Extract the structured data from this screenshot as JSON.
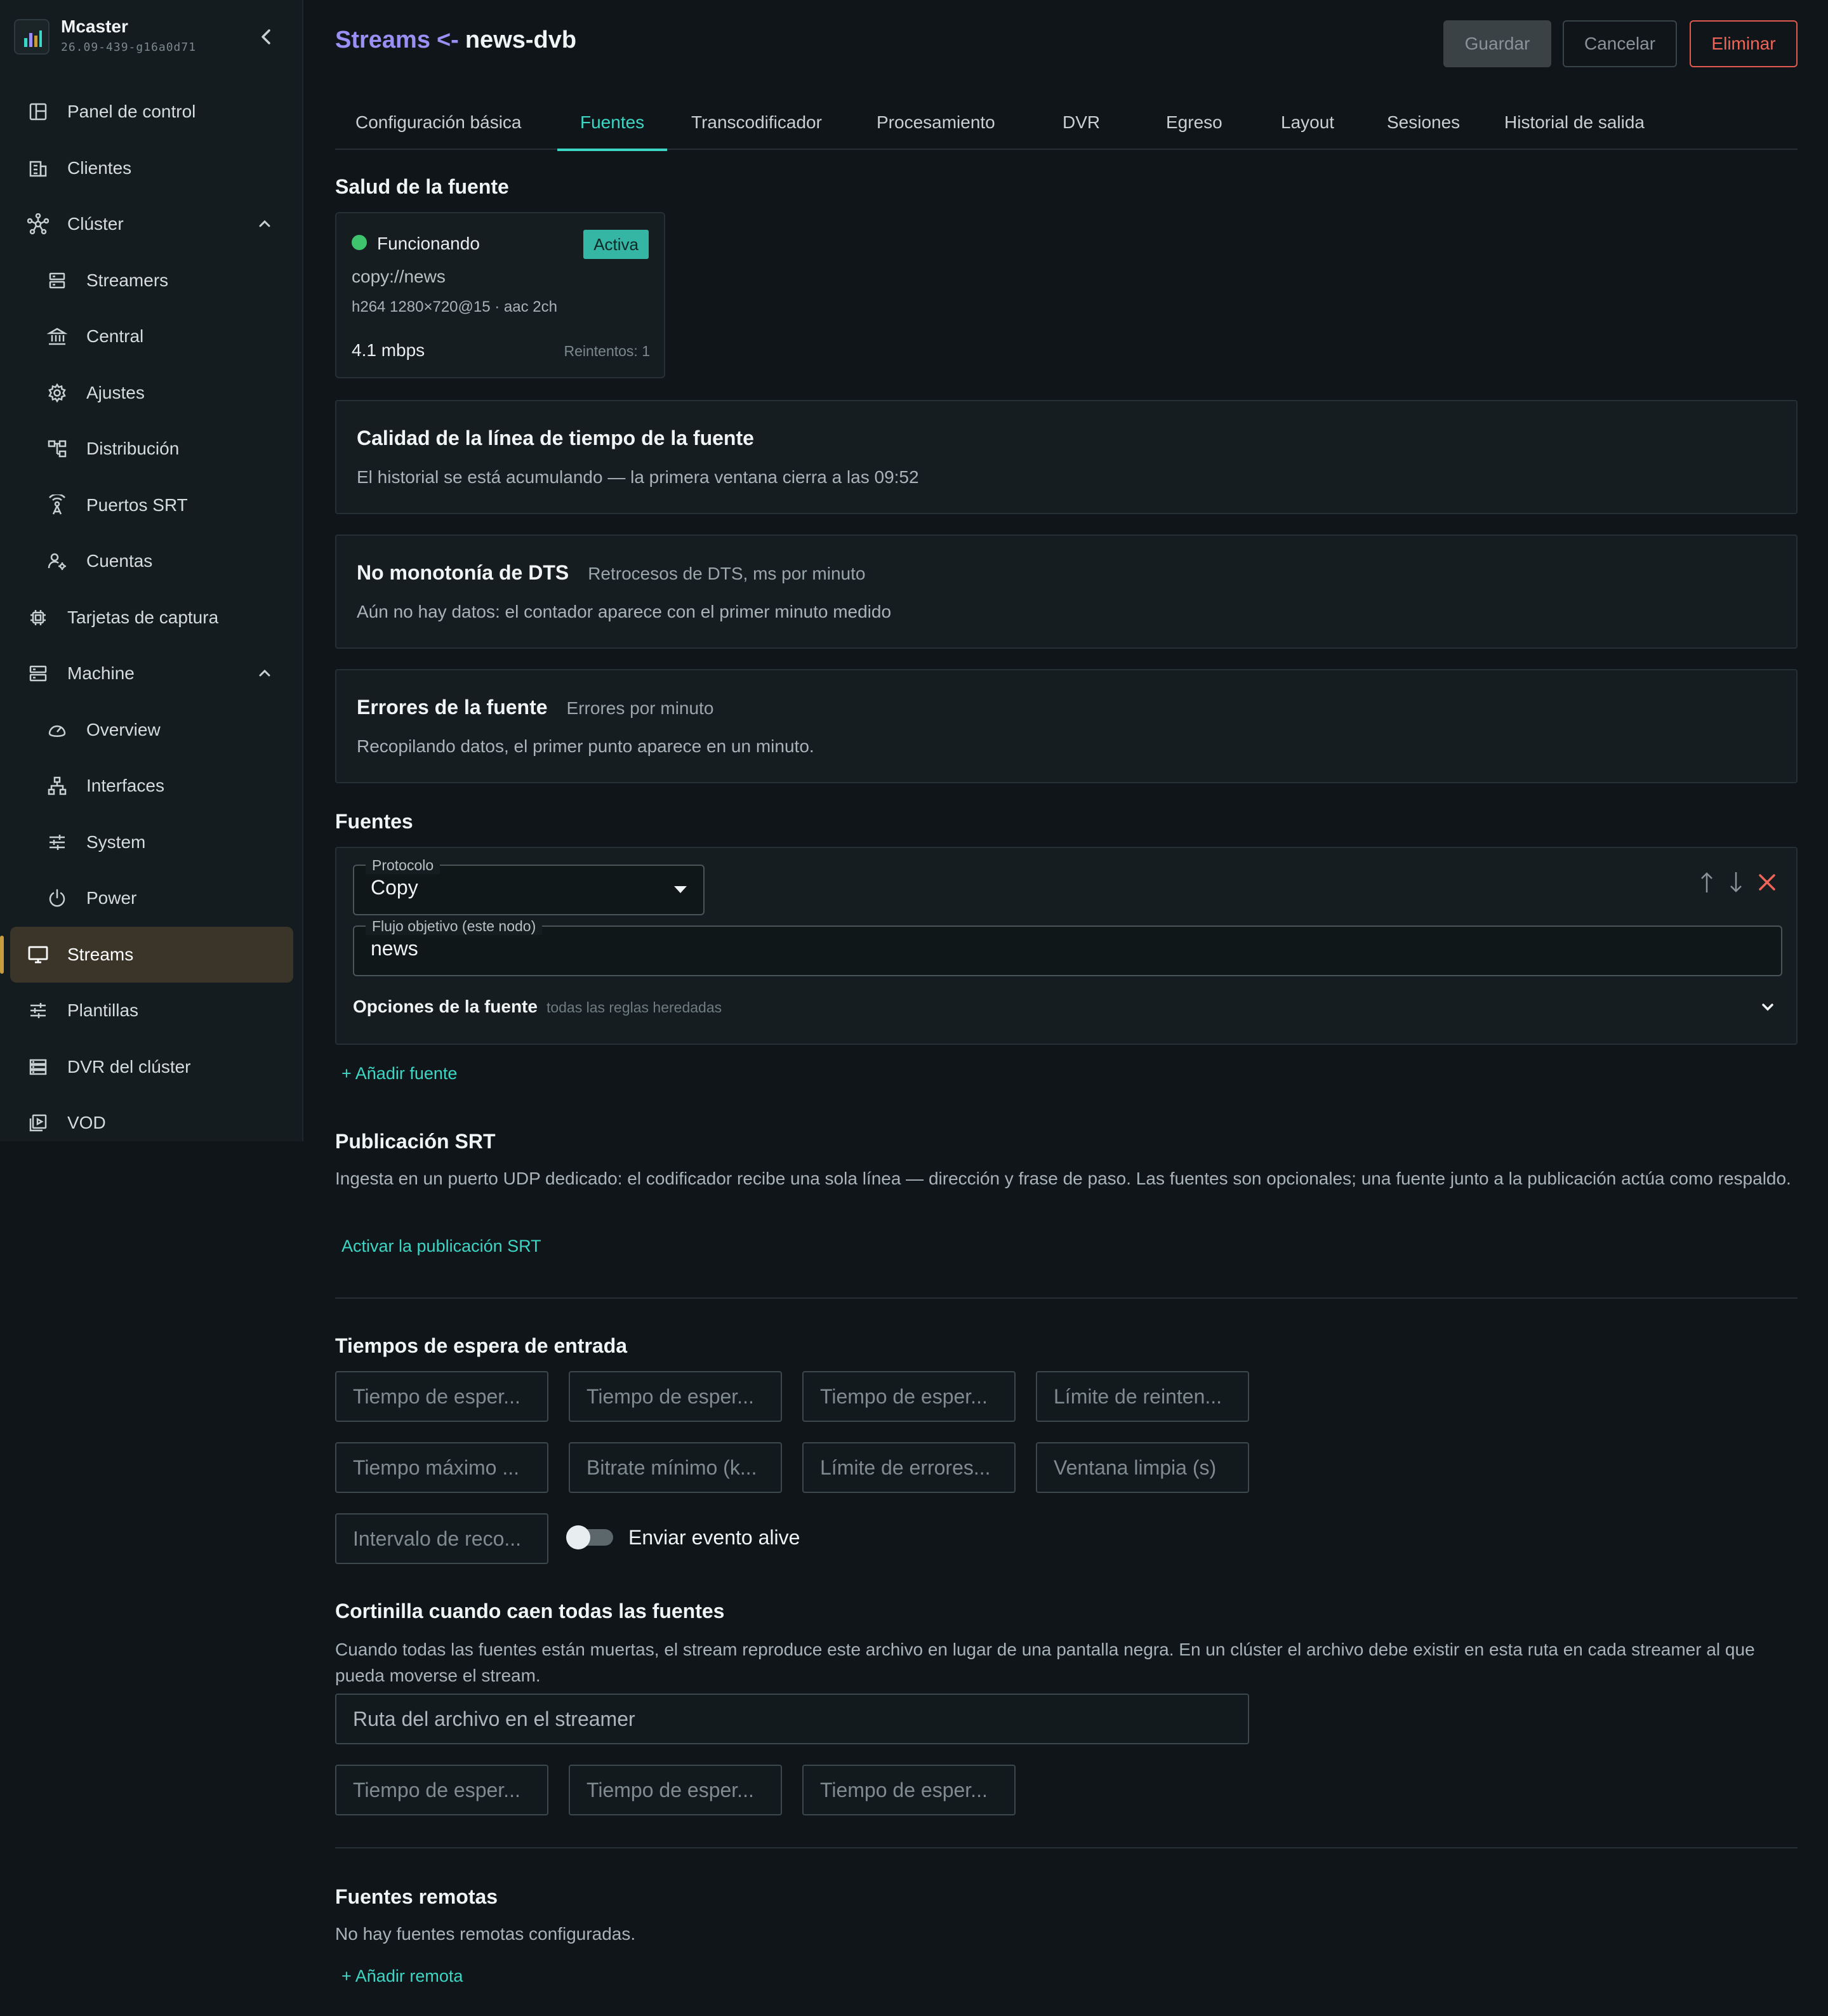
{
  "brand": {
    "name": "Mcaster",
    "version": "26.09-439-g16a0d71"
  },
  "nav": [
    {
      "label": "Panel de control",
      "icon": "dashboard-icon",
      "level": 0
    },
    {
      "label": "Clientes",
      "icon": "building-icon",
      "level": 0
    },
    {
      "label": "Clúster",
      "icon": "cluster-icon",
      "level": 0,
      "expanded": true
    },
    {
      "label": "Streamers",
      "icon": "server-icon",
      "level": 1
    },
    {
      "label": "Central",
      "icon": "bank-icon",
      "level": 1
    },
    {
      "label": "Ajustes",
      "icon": "gear-icon",
      "level": 1
    },
    {
      "label": "Distribución",
      "icon": "hierarchy-icon",
      "level": 1
    },
    {
      "label": "Puertos SRT",
      "icon": "antenna-icon",
      "level": 1
    },
    {
      "label": "Cuentas",
      "icon": "user-gear-icon",
      "level": 1
    },
    {
      "label": "Tarjetas de captura",
      "icon": "chip-icon",
      "level": 0
    },
    {
      "label": "Machine",
      "icon": "server-icon",
      "level": 0,
      "expanded": true
    },
    {
      "label": "Overview",
      "icon": "gauge-icon",
      "level": 1
    },
    {
      "label": "Interfaces",
      "icon": "network-icon",
      "level": 1
    },
    {
      "label": "System",
      "icon": "sliders-icon",
      "level": 1
    },
    {
      "label": "Power",
      "icon": "power-icon",
      "level": 1
    },
    {
      "label": "Streams",
      "icon": "monitor-icon",
      "level": 0,
      "active": true
    },
    {
      "label": "Plantillas",
      "icon": "sliders-icon",
      "level": 0
    },
    {
      "label": "DVR del clúster",
      "icon": "storage-icon",
      "level": 0
    },
    {
      "label": "VOD",
      "icon": "video-icon",
      "level": 0
    }
  ],
  "header": {
    "crumb": "Streams",
    "arrow": "<-",
    "name": "news-dvb",
    "save": "Guardar",
    "cancel": "Cancelar",
    "delete": "Eliminar"
  },
  "tabs": [
    "Configuración básica",
    "Fuentes",
    "Transcodificador",
    "Procesamiento",
    "DVR",
    "Egreso",
    "Layout",
    "Sesiones",
    "Historial de salida"
  ],
  "active_tab": "Fuentes",
  "health": {
    "title": "Salud de la fuente",
    "status": "Funcionando",
    "badge": "Activa",
    "url": "copy://news",
    "codec": "h264 1280×720@15 · aac 2ch",
    "rate": "4.1 mbps",
    "retries": "Reintentos: 1",
    "status_color": "#3ec46d"
  },
  "timeline": {
    "title": "Calidad de la línea de tiempo de la fuente",
    "desc": "El historial se está acumulando — la primera ventana cierra a las 09:52"
  },
  "dts": {
    "title": "No monotonía de DTS",
    "subtitle": "Retrocesos de DTS, ms por minuto",
    "desc": "Aún no hay datos: el contador aparece con el primer minuto medido"
  },
  "errors": {
    "title": "Errores de la fuente",
    "subtitle": "Errores por minuto",
    "desc": "Recopilando datos, el primer punto aparece en un minuto."
  },
  "sources": {
    "title": "Fuentes",
    "protocol_label": "Protocolo",
    "protocol_value": "Copy",
    "target_label": "Flujo objetivo (este nodo)",
    "target_value": "news",
    "options_label": "Opciones de la fuente",
    "options_hint": "todas las reglas heredadas",
    "add": "+ Añadir fuente"
  },
  "srt": {
    "title": "Publicación SRT",
    "desc": "Ingesta en un puerto UDP dedicado: el codificador recibe una sola línea — dirección y frase de paso. Las fuentes son opcionales; una fuente junto a la publicación actúa como respaldo.",
    "activate": "Activar la publicación SRT"
  },
  "timeouts": {
    "title": "Tiempos de espera de entrada",
    "fields": [
      "Tiempo de esper...",
      "Tiempo de esper...",
      "Tiempo de esper...",
      "Límite de reinten...",
      "Tiempo máximo ...",
      "Bitrate mínimo (k...",
      "Límite de errores...",
      "Ventana limpia (s)",
      "Intervalo de reco..."
    ],
    "alive_label": "Enviar evento alive"
  },
  "slate": {
    "title": "Cortinilla cuando caen todas las fuentes",
    "desc": "Cuando todas las fuentes están muertas, el stream reproduce este archivo en lugar de una pantalla negra. En un clúster el archivo debe existir en esta ruta en cada streamer al que pueda moverse el stream.",
    "path_placeholder": "Ruta del archivo en el streamer",
    "fields": [
      "Tiempo de esper...",
      "Tiempo de esper...",
      "Tiempo de esper..."
    ]
  },
  "remote": {
    "title": "Fuentes remotas",
    "desc": "No hay fuentes remotas configuradas.",
    "add": "+ Añadir remota"
  }
}
